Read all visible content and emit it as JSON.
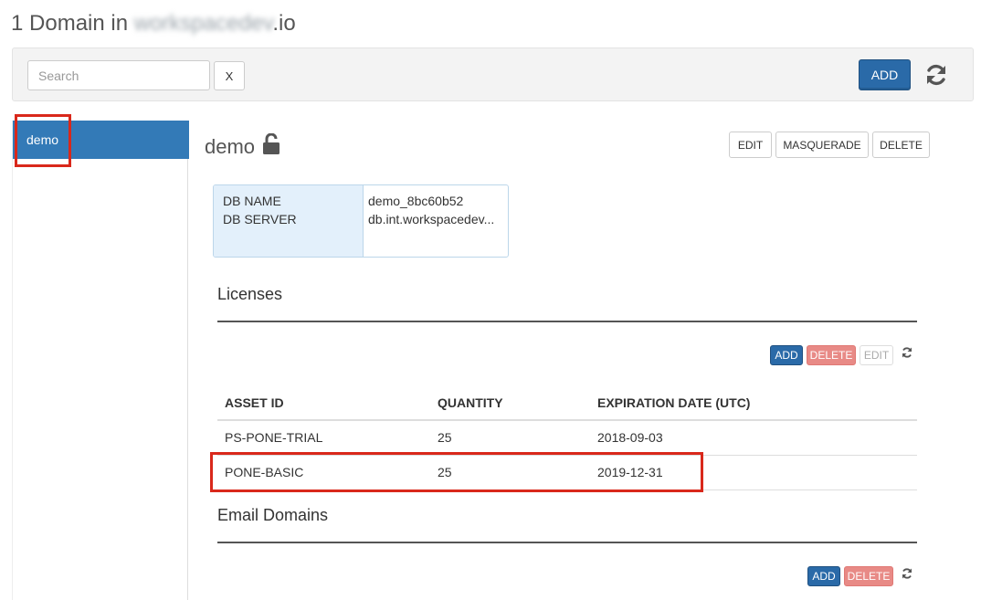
{
  "page": {
    "title_prefix": "1 Domain in ",
    "title_blurred": "workspacedev",
    "title_suffix": ".io"
  },
  "toolbar": {
    "search_placeholder": "Search",
    "clear_label": "X",
    "add_label": "ADD",
    "refresh_icon": "refresh-icon"
  },
  "sidebar": {
    "items": [
      {
        "label": "demo",
        "selected": true
      }
    ]
  },
  "domain": {
    "name": "demo",
    "lock_icon": "unlock-icon",
    "actions": {
      "edit": "EDIT",
      "masquerade": "MASQUERADE",
      "delete": "DELETE"
    },
    "db": {
      "name_label": "DB NAME",
      "server_label": "DB SERVER",
      "name_value": "demo_8bc60b52",
      "server_value": "db.int.workspacedev..."
    }
  },
  "licenses": {
    "title": "Licenses",
    "buttons": {
      "add": "ADD",
      "delete": "DELETE",
      "edit": "EDIT"
    },
    "columns": [
      "ASSET ID",
      "QUANTITY",
      "EXPIRATION DATE (UTC)"
    ],
    "rows": [
      [
        "PS-PONE-TRIAL",
        "25",
        "2018-09-03"
      ],
      [
        "PONE-BASIC",
        "25",
        "2019-12-31"
      ]
    ]
  },
  "email_domains": {
    "title": "Email Domains",
    "buttons": {
      "add": "ADD",
      "delete": "DELETE"
    }
  },
  "colors": {
    "primary": "#337ab7",
    "highlight": "#d9281b",
    "danger_light": "#e88a86"
  }
}
